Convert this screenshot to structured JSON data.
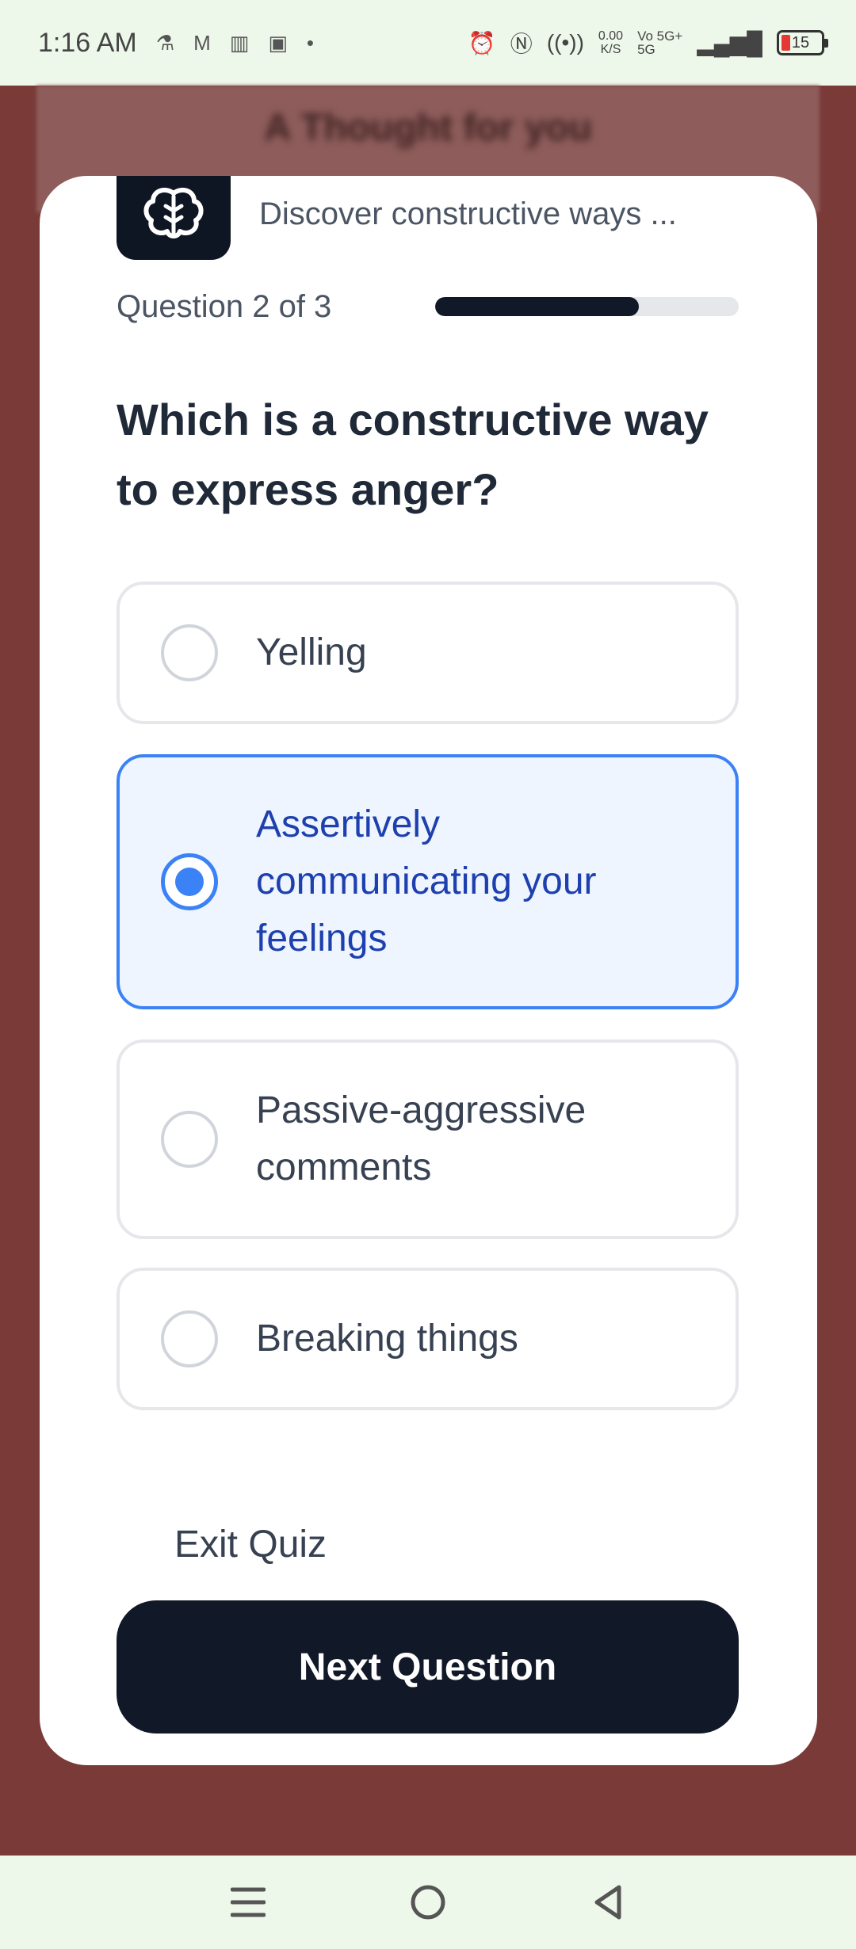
{
  "status_bar": {
    "time": "1:16 AM",
    "notif_icons": [
      "flask-icon",
      "gmail-icon",
      "chart-icon",
      "office-icon"
    ],
    "dot": "•",
    "net_speed_value": "0.00",
    "net_speed_unit": "K/S",
    "net_line1": "Vo 5G+",
    "net_line2": "5G",
    "battery": "15"
  },
  "background_app": {
    "title": "A Thought for you"
  },
  "quiz": {
    "subtitle": "Discover constructive ways ...",
    "progress_label": "Question 2 of 3",
    "progress_fraction": 0.67,
    "question": "Which is a constructive way to express anger?",
    "options": [
      {
        "label": "Yelling",
        "selected": false
      },
      {
        "label": "Assertively communicating your feelings",
        "selected": true
      },
      {
        "label": "Passive-aggressive comments",
        "selected": false
      },
      {
        "label": "Breaking things",
        "selected": false
      }
    ],
    "exit_label": "Exit Quiz",
    "next_label": "Next Question"
  },
  "colors": {
    "accent": "#3b82f6",
    "dark": "#111827",
    "backdrop": "#7a3a38"
  }
}
